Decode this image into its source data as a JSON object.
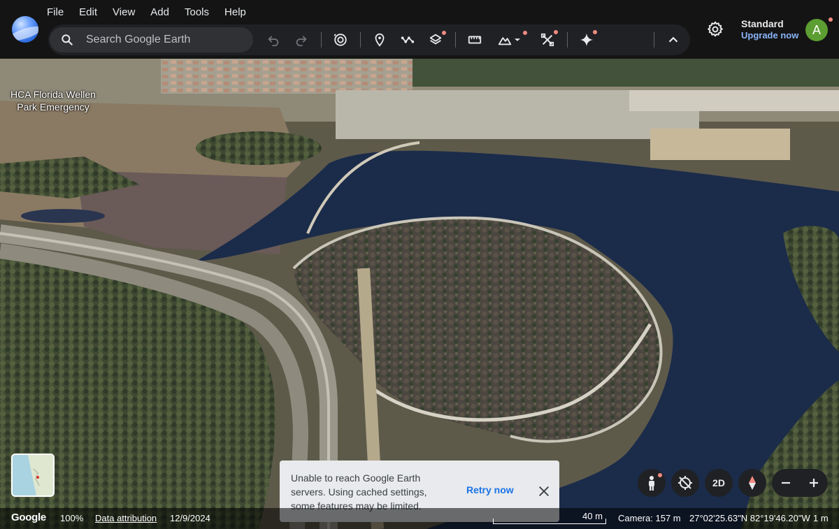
{
  "menu": [
    "File",
    "Edit",
    "View",
    "Add",
    "Tools",
    "Help"
  ],
  "search": {
    "placeholder": "Search Google Earth",
    "icon": "search-icon"
  },
  "toolbar": {
    "tools": [
      "undo-icon",
      "redo-icon",
      "history-icon",
      "placemark-icon",
      "path-icon",
      "layers-icon",
      "measure-icon",
      "map-style-icon",
      "chevron-down-icon",
      "satellite-tools-icon",
      "gemini-icon",
      "collapse-icon"
    ]
  },
  "account": {
    "plan": "Standard",
    "upgrade": "Upgrade now",
    "avatar_letter": "A"
  },
  "map": {
    "label_line1": "HCA Florida Wellen",
    "label_line2": "Park Emergency"
  },
  "toast": {
    "message": "Unable to reach Google Earth servers. Using cached settings, some features may be limited.",
    "retry": "Retry now"
  },
  "controls": {
    "mode_2d": "2D"
  },
  "status": {
    "brand": "Google",
    "zoom": "100%",
    "attribution": "Data attribution",
    "date": "12/9/2024",
    "scale": "40 m",
    "camera": "Camera: 157 m",
    "coords": "27°02'25.63\"N 82°19'46.20\"W",
    "elevation": "1 m"
  },
  "colors": {
    "accent": "#8ab4f8",
    "link": "#1a73e8",
    "notify": "#f28b82",
    "avatar": "#5c9e31",
    "water": "#1b2b4a"
  }
}
